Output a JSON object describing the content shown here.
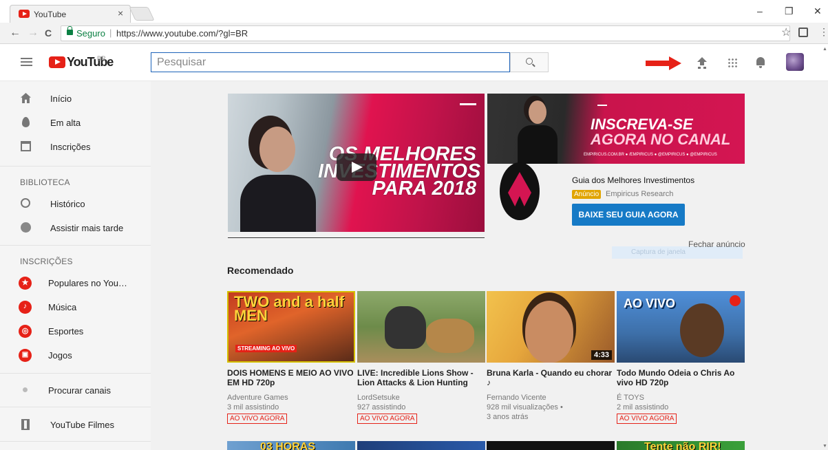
{
  "browser": {
    "tab_title": "YouTube",
    "tab_close": "×",
    "window_minimize": "–",
    "window_maximize": "❐",
    "window_close": "✕",
    "back": "←",
    "forward": "→",
    "reload": "C",
    "secure_label": "Seguro",
    "url": "https://www.youtube.com/?gl=BR",
    "bookmark_star": "☆",
    "menu": "⋮"
  },
  "masthead": {
    "logo_text": "YouTube",
    "country": "BR",
    "search_placeholder": "Pesquisar",
    "accent_color": "#e62117"
  },
  "sidebar": {
    "main_items": [
      {
        "label": "Início",
        "icon": "home-icon"
      },
      {
        "label": "Em alta",
        "icon": "flame-icon"
      },
      {
        "label": "Inscrições",
        "icon": "subscriptions-icon"
      }
    ],
    "library_title": "BIBLIOTECA",
    "library_items": [
      {
        "label": "Histórico",
        "icon": "history-icon"
      },
      {
        "label": "Assistir mais tarde",
        "icon": "clock-icon"
      }
    ],
    "subs_title": "INSCRIÇÕES",
    "subs_items": [
      {
        "label": "Populares no You…",
        "icon": "star-icon"
      },
      {
        "label": "Música",
        "icon": "music-icon"
      },
      {
        "label": "Esportes",
        "icon": "sports-icon"
      },
      {
        "label": "Jogos",
        "icon": "games-icon"
      }
    ],
    "browse_channels": "Procurar canais",
    "movies": "YouTube Filmes"
  },
  "ad": {
    "video_headline": "OS MELHORES INVESTIMENTOS PARA 2018",
    "banner_line1": "INSCREVA-SE",
    "banner_line2": "AGORA NO CANAL",
    "banner_small": "EMPIRICUS.COM.BR  ● /EMPIRICUS  ● @EMPIRICUS  ● @EMPIRICUS",
    "title": "Guia dos Melhores Investimentos",
    "badge": "Anúncio",
    "advertiser": "Empiricus Research",
    "cta": "BAIXE SEU GUIA AGORA",
    "close": "Fechar anúncio",
    "capture_overlay": "Captura de janela"
  },
  "recommended": {
    "title": "Recomendado",
    "videos": [
      {
        "thumb_text": "TWO and a half MEN",
        "thumb_sub": "STREAMING AO VIVO",
        "title": "DOIS HOMENS E MEIO AO VIVO EM HD 720p",
        "channel": "Adventure Games",
        "meta1": "3 mil assistindo",
        "meta2": "",
        "badge": "AO VIVO AGORA",
        "duration": ""
      },
      {
        "thumb_text": "",
        "thumb_sub": "",
        "title": "LIVE: Incredible Lions Show - Lion Attacks & Lion Hunting",
        "channel": "LordSetsuke",
        "meta1": "927 assistindo",
        "meta2": "",
        "badge": "AO VIVO AGORA",
        "duration": ""
      },
      {
        "thumb_text": "",
        "thumb_sub": "",
        "title": "Bruna Karla - Quando eu chorar ♪",
        "channel": "Fernando Vicente",
        "meta1": "928 mil visualizações •",
        "meta2": "3 anos atrás",
        "badge": "",
        "duration": "4:33"
      },
      {
        "thumb_text": "AO VIVO",
        "thumb_sub": "",
        "title": "Todo Mundo Odeia o Chris Ao vivo HD 720p",
        "channel": "É TOYS",
        "meta1": "2 mil assistindo",
        "meta2": "",
        "badge": "AO VIVO AGORA",
        "duration": ""
      }
    ],
    "next_row": [
      "03 HORAS",
      "",
      "",
      "Tente não RIR!"
    ]
  }
}
